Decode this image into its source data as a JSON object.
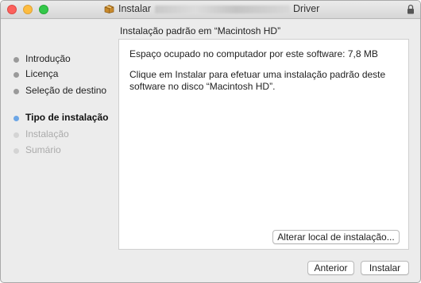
{
  "window": {
    "title_prefix": "Instalar",
    "title_suffix": "Driver"
  },
  "sidebar": {
    "steps": [
      {
        "label": "Introdução",
        "state": "done"
      },
      {
        "label": "Licença",
        "state": "done"
      },
      {
        "label": "Seleção de destino",
        "state": "done"
      },
      {
        "label": "Tipo de instalação",
        "state": "current"
      },
      {
        "label": "Instalação",
        "state": "todo"
      },
      {
        "label": "Sumário",
        "state": "todo"
      }
    ]
  },
  "pane": {
    "title": "Instalação padrão em “Macintosh HD”",
    "space_text": "Espaço ocupado no computador por este software: 7,8 MB",
    "instruction_text": "Clique em Instalar para efetuar uma instalação padrão deste software no disco “Macintosh HD”.",
    "change_location_button": "Alterar local de instalação..."
  },
  "footer": {
    "back_button": "Anterior",
    "install_button": "Instalar"
  },
  "colors": {
    "current_step_dot": "#6ca6e6",
    "close": "#fc605c",
    "minimize": "#fdbc40",
    "zoom": "#34c84a"
  },
  "icons": {
    "title_icon": "package-icon",
    "lock": "lock-icon"
  }
}
